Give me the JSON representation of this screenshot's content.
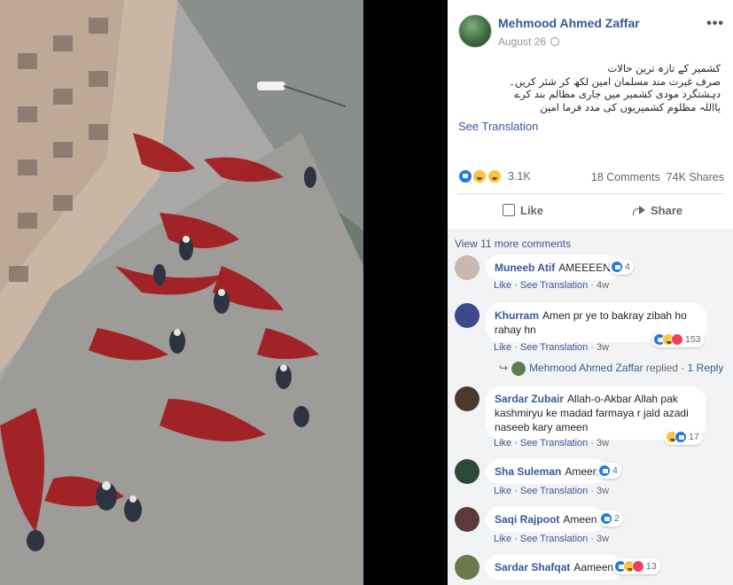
{
  "post": {
    "author": "Mehmood Ahmed Zaffar",
    "date": "August 26",
    "more_icon": "ellipsis-icon",
    "text_lines": [
      "کشمیر کے تازہ ترین حالات",
      "صرف غیرت مند مسلمان امین لکھ کر شئر کریں۔",
      "دہشتگرد مودی کشمیر میں جاری مظالم بند کرے",
      "یااللہ مظلوم کشمیریوں کی مدد فرما امین"
    ],
    "see_translation": "See Translation",
    "reaction_count": "3.1K",
    "comments": "18 Comments",
    "shares": "74K Shares",
    "like_label": "Like",
    "share_label": "Share"
  },
  "comments_section": {
    "view_more": "View 11 more comments",
    "like_label": "Like",
    "see_translation": "See Translation",
    "items": [
      {
        "name": "Muneeb Atif",
        "text": "AMEEEEN",
        "time": "4w",
        "reactions": "4",
        "avatar_color": "#c9b8b0"
      },
      {
        "name": "Khurram",
        "text": "Amen pr ye to bakray zibah ho rahay hn",
        "time": "3w",
        "reactions": "153",
        "avatar_color": "#3a4a8a"
      },
      {
        "name": "Sardar Zubair",
        "text": "Allah-o-Akbar Allah pak kashmiryu ke madad farmaya r jald azadi naseeb kary ameen",
        "time": "3w",
        "reactions": "17",
        "avatar_color": "#4a3a2a"
      },
      {
        "name": "Sha Suleman",
        "text": "Ameen",
        "time": "3w",
        "reactions": "4",
        "avatar_color": "#2a4a3a"
      },
      {
        "name": "Saqi Rajpoot",
        "text": "Ameen",
        "time": "3w",
        "reactions": "2",
        "avatar_color": "#5a3a3a"
      },
      {
        "name": "Sardar Shafqat",
        "text": "Aameen",
        "time": "",
        "reactions": "13",
        "avatar_color": "#6a7a4a"
      }
    ],
    "reply": {
      "name": "Mehmood Ahmed Zaffar",
      "replied": "replied",
      "sep": "·",
      "count": "1 Reply"
    }
  },
  "colors": {
    "link": "#385898",
    "panel_bg": "#ffffff",
    "comments_bg": "#f2f3f5"
  }
}
